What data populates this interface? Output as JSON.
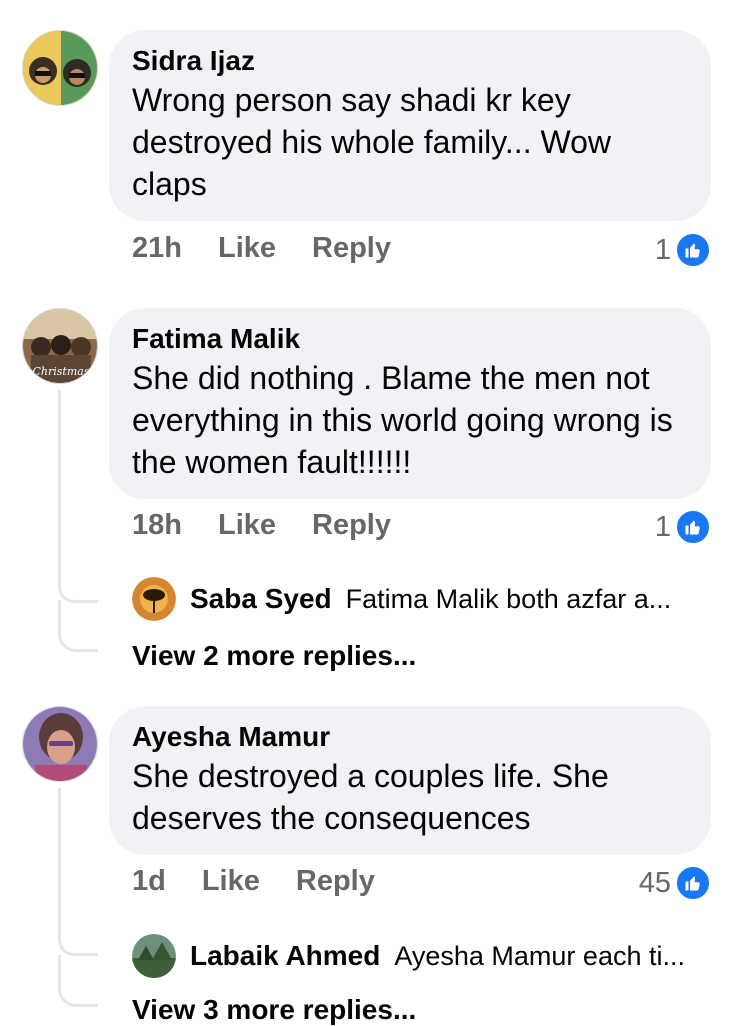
{
  "comments": [
    {
      "author": "Sidra Ijaz",
      "text": "Wrong person say shadi kr key destroyed his whole family... Wow claps",
      "time": "21h",
      "like_label": "Like",
      "reply_label": "Reply",
      "reaction_count": "1"
    },
    {
      "author": "Fatima Malik",
      "text": "She did nothing . Blame the men not everything in this world going wrong is the women fault!!!!!!",
      "avatar_caption": "Christmas",
      "time": "18h",
      "like_label": "Like",
      "reply_label": "Reply",
      "reaction_count": "1",
      "reply_preview": {
        "author": "Saba Syed",
        "text": "Fatima Malik  both azfar a..."
      },
      "view_more": "View 2 more replies..."
    },
    {
      "author": "Ayesha Mamur",
      "text": "She destroyed a couples life. She deserves the consequences",
      "time": "1d",
      "like_label": "Like",
      "reply_label": "Reply",
      "reaction_count": "45",
      "reply_preview": {
        "author": "Labaik Ahmed",
        "text": "Ayesha Mamur  each ti..."
      },
      "view_more": "View 3 more replies..."
    }
  ],
  "colors": {
    "like_blue": "#1877f2",
    "bubble_bg": "#f0f2f5",
    "meta_gray": "#65676b"
  },
  "icons": {
    "reaction": "thumbs-up-icon"
  }
}
